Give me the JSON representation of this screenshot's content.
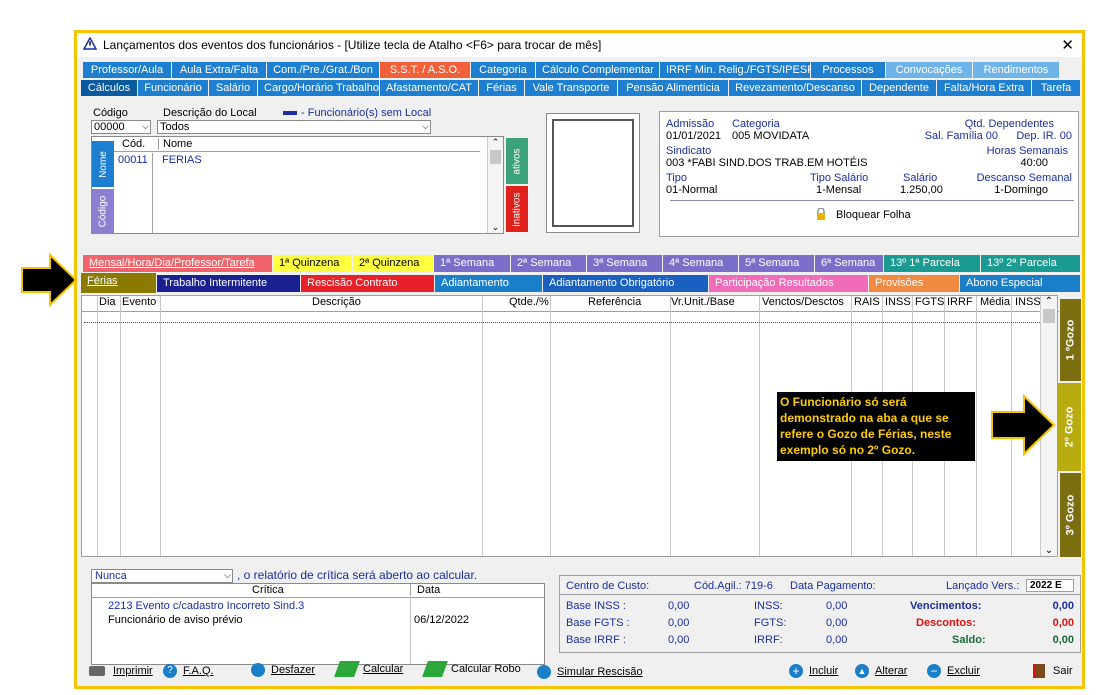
{
  "window": {
    "title": "Lançamentos dos eventos dos funcionários - [Utilize tecla de Atalho <F6> para trocar de mês]"
  },
  "tabs_row1": [
    "Professor/Aula",
    "Aula Extra/Falta",
    "Com./Pre./Grat./Bon",
    "S.S.T. / A.S.O.",
    "Categoria",
    "Cálculo Complementar",
    "IRRF Min. Relig./FGTS/IPESP",
    "Processos",
    "Convocações",
    "Rendimentos"
  ],
  "tabs_row2": [
    "Cálculos",
    "Funcionário",
    "Salário",
    "Cargo/Horário Trabalho",
    "Afastamento/CAT",
    "Férias",
    "Vale Transporte",
    "Pensão Alimentícia",
    "Revezamento/Descanso",
    "Dependente",
    "Falta/Hora Extra",
    "Tarefa"
  ],
  "filter": {
    "codigo_label": "Código",
    "codigo_value": "00000",
    "local_label": "Descrição do Local",
    "local_value": "Todos",
    "legend": "- Funcionário(s) sem Local"
  },
  "emp_list": {
    "col_cod": "Cód.",
    "col_nome": "Nome",
    "rows": [
      {
        "cod": "00011",
        "nome": "FERIAS"
      }
    ],
    "side_nome": "Nome",
    "side_codigo": "Código",
    "btn_ativos": "ativos",
    "btn_inativos": "inativos"
  },
  "info": {
    "admissao_label": "Admissão",
    "admissao": "01/01/2021",
    "categoria_label": "Categoria",
    "categoria": "005  MOVIDATA",
    "qtd_dep_label": "Qtd. Dependentes",
    "sal_fam": "Sal. Família 00",
    "dep_ir": "Dep. IR. 00",
    "sindicato_label": "Sindicato",
    "sindicato": "003  *FABI SIND.DOS TRAB.EM HOTÉIS",
    "horas_label": "Horas Semanais",
    "horas": "40:00",
    "tipo_label": "Tipo",
    "tipo": "01-Normal",
    "tipo_sal_label": "Tipo Salário",
    "tipo_sal": "1-Mensal",
    "salario_label": "Salário",
    "salario": "1.250,00",
    "descanso_label": "Descanso Semanal",
    "descanso": "1-Domingo",
    "bloquear": "Bloquear Folha"
  },
  "period_tabs": [
    "Mensal/Hora/Dia/Professor/Tarefa",
    "1ª Quinzena",
    "2ª Quinzena",
    "1ª Semana",
    "2ª Semana",
    "3ª Semana",
    "4ª Semana",
    "5ª Semana",
    "6ª Semana",
    "13º  1ª Parcela",
    "13º  2ª  Parcela"
  ],
  "type_tabs": [
    "Férias",
    "Trabalho Intermitente",
    "Rescisão Contrato",
    "Adiantamento",
    "Adiantamento Obrigatório",
    "Participação Resultados",
    "Provisões",
    "Abono Especial"
  ],
  "grid_cols": [
    "Dia",
    "Evento",
    "Descrição",
    "Qtde./%",
    "Referência",
    "Vr.Unit./Base",
    "Venctos/Desctos",
    "RAIS",
    "INSS",
    "FGTS",
    "IRRF",
    "Média",
    "INSS"
  ],
  "gozo_tabs": [
    "1 ºGozo",
    "2º Gozo",
    "3º Gozo"
  ],
  "callout": "O Funcionário só será demonstrado na aba a que se refere o Gozo de Férias, neste exemplo só no 2º Gozo.",
  "critica": {
    "select": "Nunca",
    "text": ", o relatório de crítica será aberto ao calcular.",
    "col_critica": "Crítica",
    "col_data": "Data",
    "rows": [
      {
        "critica": "2213 Evento c/cadastro Incorreto Sind.3",
        "data": ""
      },
      {
        "critica": "Funcionário de aviso prévio",
        "data": "06/12/2022"
      }
    ]
  },
  "totals": {
    "centro_custo": "Centro de Custo:",
    "cod_agil": "Cód.Agil.:  719-6",
    "data_pag": "Data Pagamento:",
    "lancado": "Lançado Vers.:",
    "versao": "2022 E",
    "base_inss_l": "Base  INSS :",
    "base_inss": "0,00",
    "inss_l": "INSS:",
    "inss": "0,00",
    "venc_l": "Vencimentos:",
    "venc": "0,00",
    "base_fgts_l": "Base FGTS :",
    "base_fgts": "0,00",
    "fgts_l": "FGTS:",
    "fgts": "0,00",
    "desc_l": "Descontos:",
    "desc": "0,00",
    "base_irrf_l": "Base  IRRF :",
    "base_irrf": "0,00",
    "irrf_l": "IRRF:",
    "irrf": "0,00",
    "saldo_l": "Saldo:",
    "saldo": "0,00"
  },
  "toolbar": {
    "imprimir": "Imprimir",
    "faq": "F.A.Q.",
    "desfazer": "Desfazer",
    "calcular": "Calcular",
    "calcular_robo": "Calcular Robo",
    "simular": "Simular Rescisão",
    "incluir": "Incluir",
    "alterar": "Alterar",
    "excluir": "Excluir",
    "sair": "Sair"
  }
}
